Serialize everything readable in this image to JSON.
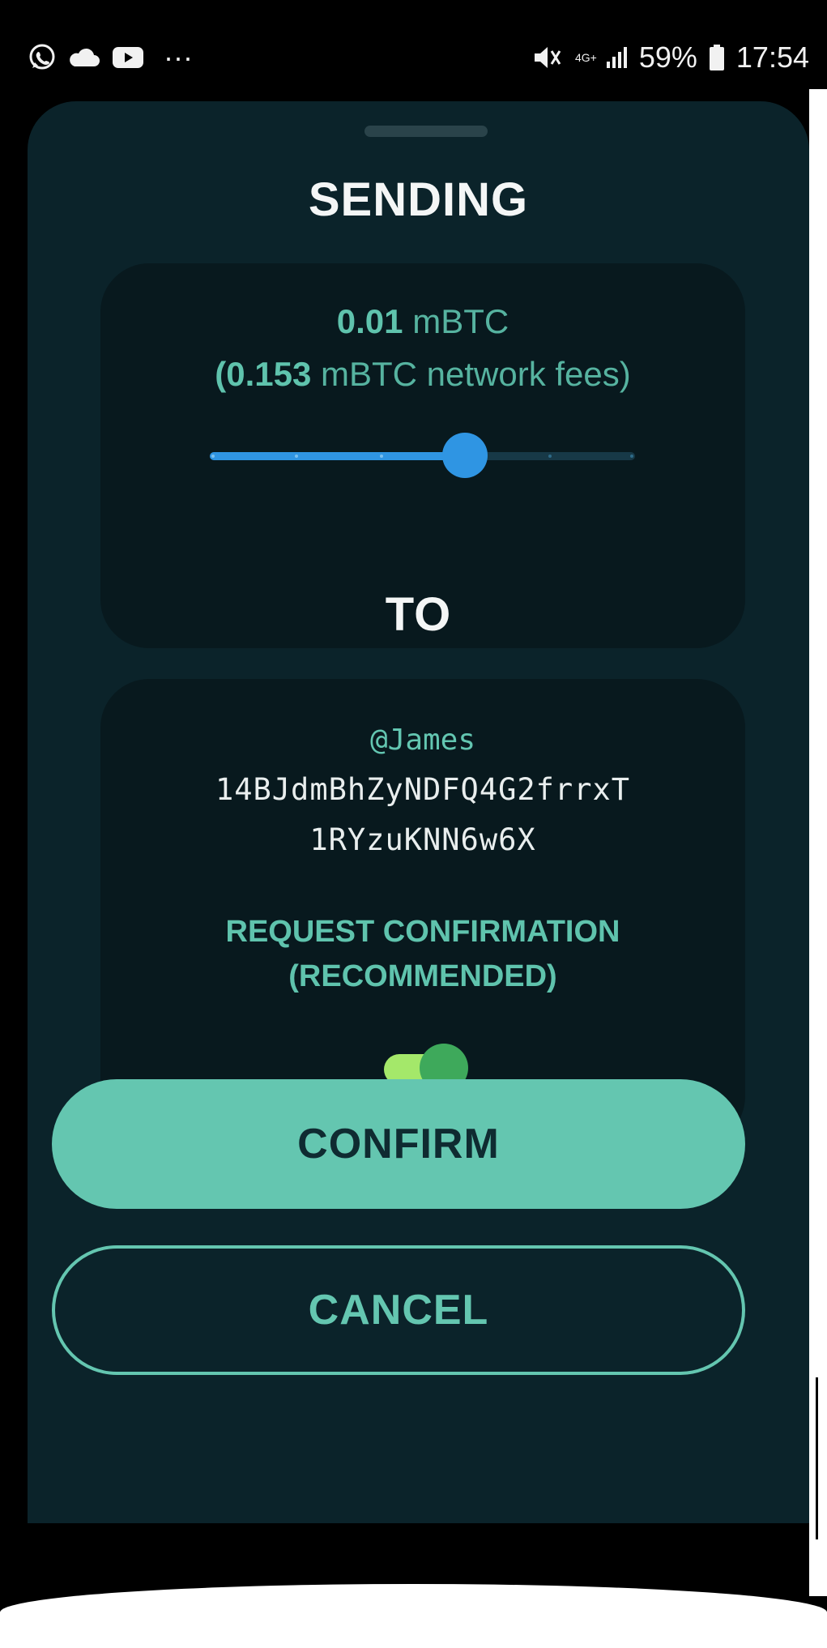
{
  "status_bar": {
    "icons_left": [
      "whatsapp-icon",
      "cloud-icon",
      "youtube-icon",
      "more-icon"
    ],
    "more_text": "···",
    "network_type": "4G+",
    "battery_percent": "59%",
    "time": "17:54",
    "icons_right": [
      "mute-icon",
      "signal-icon",
      "battery-icon"
    ]
  },
  "sheet": {
    "sending_title": "SENDING",
    "amount_value": "0.01",
    "amount_unit": "mBTC",
    "fee_open": "(",
    "fee_value": "0.153",
    "fee_unit": "mBTC network fees)",
    "fee_slider_level": 0.6,
    "to_title": "TO",
    "recipient": {
      "name": "@James",
      "address_line1": "14BJdmBhZyNDFQ4G2frrxT",
      "address_line2": "1RYzuKNN6w6X"
    },
    "request_confirmation": {
      "line1": "REQUEST CONFIRMATION",
      "line2": "(RECOMMENDED)",
      "enabled": true
    }
  },
  "buttons": {
    "confirm_label": "CONFIRM",
    "cancel_label": "CANCEL"
  },
  "colors": {
    "background": "#0b232a",
    "card": "#08191e",
    "accent": "#64c6b0",
    "slider": "#2f95e3",
    "toggle_on": "#3ea95b"
  }
}
